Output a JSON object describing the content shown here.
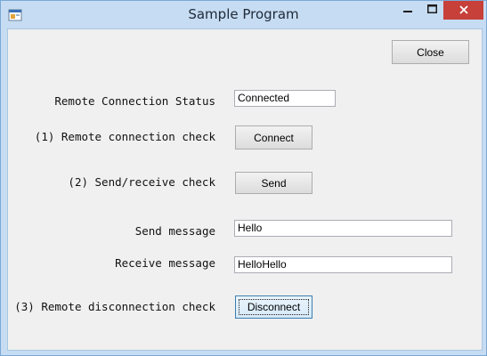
{
  "window": {
    "title": "Sample Program"
  },
  "titlebar": {
    "minimize_icon": "minimize-icon",
    "maximize_icon": "maximize-icon",
    "close_icon": "close-icon",
    "close_color": "#c7403a"
  },
  "form": {
    "close_button": "Close",
    "status_label": "Remote Connection Status",
    "status_value": "Connected",
    "connect_check_label": "(1) Remote connection check",
    "connect_button": "Connect",
    "send_check_label": "(2) Send/receive check",
    "send_button": "Send",
    "send_message_label": "Send message",
    "send_message_value": "Hello",
    "receive_message_label": "Receive message",
    "receive_message_value": "HelloHello",
    "disconnect_check_label": "(3) Remote disconnection check",
    "disconnect_button": "Disconnect"
  }
}
